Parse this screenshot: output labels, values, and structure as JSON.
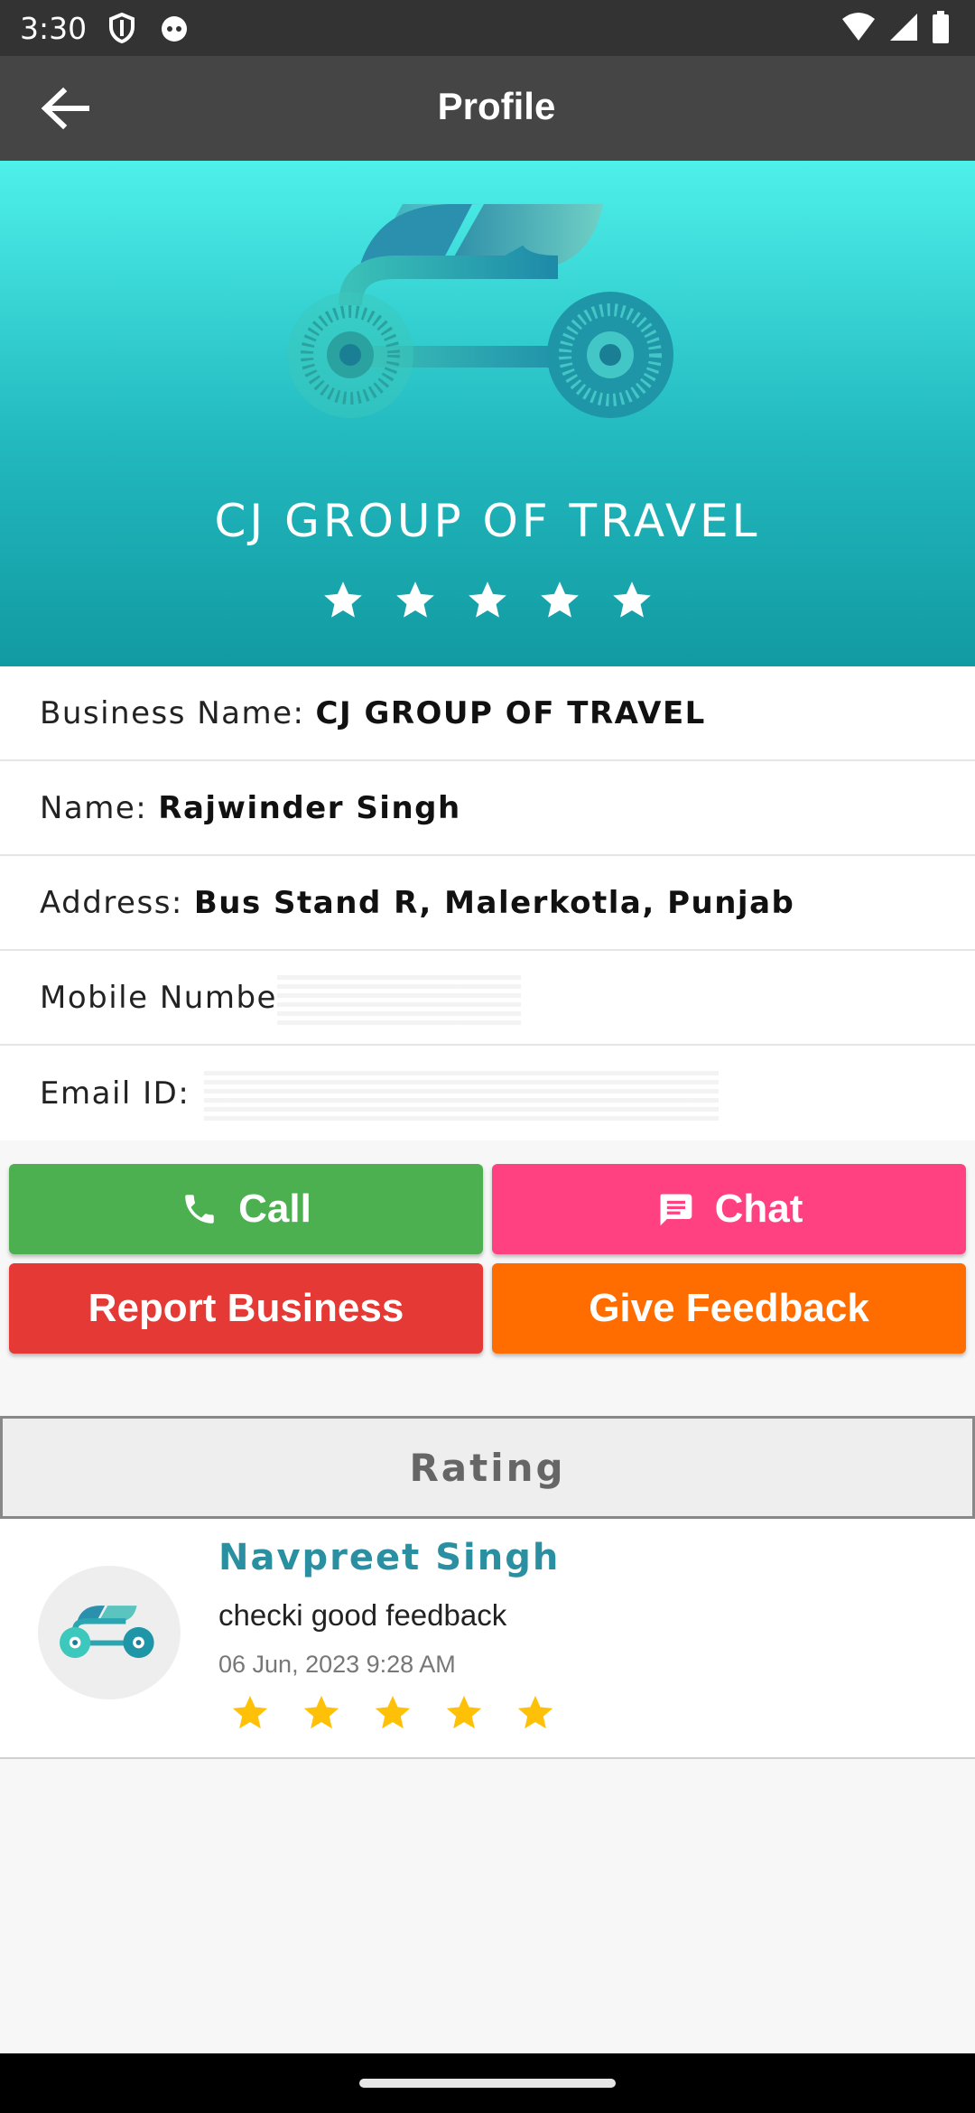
{
  "status_bar": {
    "time": "3:30"
  },
  "app_bar": {
    "title": "Profile"
  },
  "hero": {
    "business_name": "CJ GROUP OF TRAVEL",
    "rating": 5,
    "rating_max": 5,
    "star_color": "#ffffff"
  },
  "info": {
    "business_name_label": "Business Name:",
    "business_name_value": "CJ GROUP OF TRAVEL",
    "name_label": "Name:",
    "name_value": "Rajwinder Singh",
    "address_label": "Address:",
    "address_value": "Bus Stand R, Malerkotla, Punjab",
    "mobile_label": "Mobile Numbe",
    "email_label": "Email ID:"
  },
  "buttons": {
    "call": "Call",
    "chat": "Chat",
    "report": "Report Business",
    "feedback": "Give Feedback"
  },
  "colors": {
    "call": "#4caf50",
    "chat": "#ff4081",
    "report": "#e53935",
    "feedback": "#ff6d00",
    "accent": "#2a8fa0"
  },
  "rating_section": {
    "header": "Rating"
  },
  "reviews": [
    {
      "name": "Navpreet Singh",
      "comment": "checki good feedback",
      "date": "06 Jun, 2023 9:28 AM",
      "rating": 5,
      "star_color": "#ffc107"
    }
  ]
}
